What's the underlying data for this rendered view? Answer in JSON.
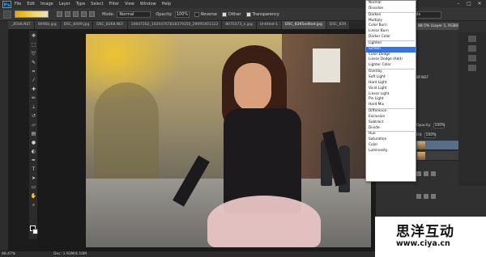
{
  "app": {
    "logo": "Ps"
  },
  "menu": [
    "File",
    "Edit",
    "Image",
    "Layer",
    "Type",
    "Select",
    "Filter",
    "View",
    "Window",
    "Help"
  ],
  "options": {
    "mode_label": "Mode:",
    "mode_value": "Normal",
    "opacity_label": "Opacity:",
    "opacity_value": "100%",
    "reverse_label": "Reverse",
    "dither_label": "Dither",
    "transparency_label": "Transparency",
    "workspace": "Essentials"
  },
  "tabs": [
    "_8508.NEF",
    "8096b.jpg",
    "DSC_8409.jpg",
    "DSC_8368.NEF",
    "10647202_10204767818379350_29095401123",
    "8070373_n.jpg",
    "Untitled-1",
    "DSC_8395edited.jpg",
    "DSC_839"
  ],
  "blend_modes": [
    [
      "Normal",
      "Dissolve"
    ],
    [
      "Darken",
      "Multiply",
      "Color Burn",
      "Linear Burn",
      "Darker Color"
    ],
    [
      "Lighten",
      "Screen",
      "Color Dodge",
      "Linear Dodge (Add)",
      "Lighter Color"
    ],
    [
      "Overlay",
      "Soft Light",
      "Hard Light",
      "Vivid Light",
      "Linear Light",
      "Pin Light",
      "Hard Mix"
    ],
    [
      "Difference",
      "Exclusion",
      "Subtract",
      "Divide"
    ],
    [
      "Hue",
      "Saturation",
      "Color",
      "Luminosity"
    ]
  ],
  "blend_highlighted": "Screen",
  "right_panel": {
    "doc_title": "88.5% (Layer 1, RGB/8*)",
    "layer_name": "8F.NEF",
    "opacity_label": "Opacity:",
    "opacity_value": "100%",
    "fill_label": "Fill:",
    "fill_value": "100%"
  },
  "status": {
    "zoom": "88.47%",
    "doc": "Doc: 1.93M/4.10M"
  },
  "watermark": {
    "cn": "思洋互动",
    "url": "www.ciya.cn"
  },
  "colors": {
    "accent": "#3a72d8",
    "ps_blue": "#31a8ff"
  },
  "icons": [
    "move-icon",
    "marquee-icon",
    "lasso-icon",
    "quick-select-icon",
    "crop-icon",
    "eyedropper-icon",
    "healing-icon",
    "brush-icon",
    "clone-stamp-icon",
    "history-brush-icon",
    "eraser-icon",
    "gradient-icon",
    "blur-icon",
    "dodge-icon",
    "pen-icon",
    "type-icon",
    "path-select-icon",
    "shape-icon",
    "hand-icon",
    "zoom-icon"
  ]
}
